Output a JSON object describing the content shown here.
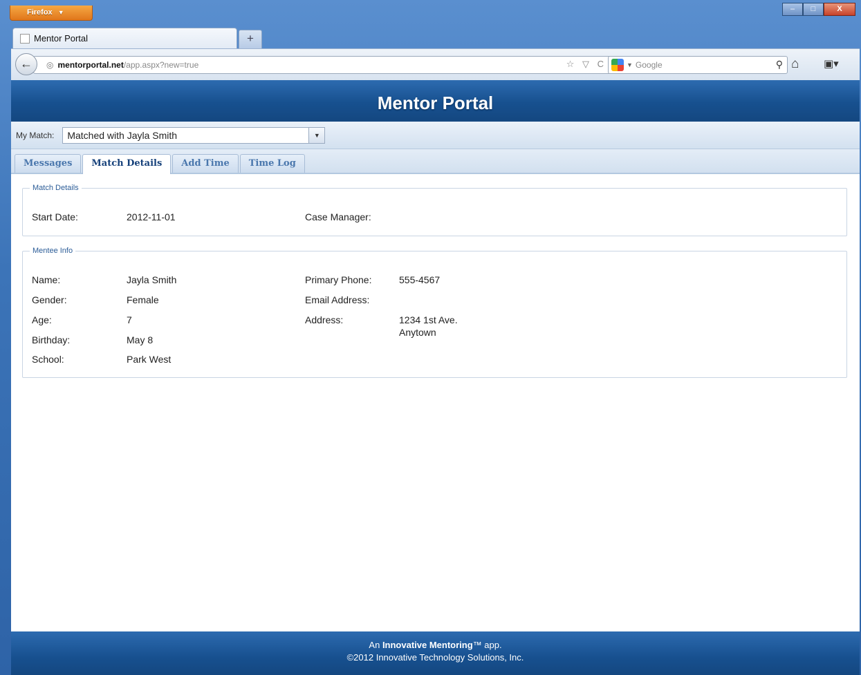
{
  "browser": {
    "menu_button_label": "Firefox",
    "menu_caret": "▼",
    "window_controls": {
      "minimize": "–",
      "maximize": "□",
      "close": "X"
    },
    "tab_title": "Mentor Portal",
    "new_tab_label": "+",
    "url_domain": "mentorportal.net",
    "url_path": "/app.aspx?new=true",
    "url_actions": "☆ ▽ C",
    "search_placeholder": "Google",
    "search_caret": "▼"
  },
  "app": {
    "title": "Mentor Portal",
    "match_label": "My Match:",
    "match_selected": "Matched with Jayla Smith",
    "tabs": [
      {
        "label": "Messages",
        "active": false
      },
      {
        "label": "Match Details",
        "active": true
      },
      {
        "label": "Add Time",
        "active": false
      },
      {
        "label": "Time Log",
        "active": false
      }
    ]
  },
  "match_details": {
    "legend": "Match Details",
    "start_date_label": "Start Date:",
    "start_date_value": "2012-11-01",
    "case_manager_label": "Case Manager:",
    "case_manager_value": ""
  },
  "mentee_info": {
    "legend": "Mentee Info",
    "name_label": "Name:",
    "name_value": "Jayla Smith",
    "gender_label": "Gender:",
    "gender_value": "Female",
    "age_label": "Age:",
    "age_value": "7",
    "birthday_label": "Birthday:",
    "birthday_value": "May 8",
    "school_label": "School:",
    "school_value": "Park West",
    "phone_label": "Primary Phone:",
    "phone_value": "555-4567",
    "email_label": "Email Address:",
    "email_value": "",
    "address_label": "Address:",
    "address_line1": "1234 1st Ave.",
    "address_line2": "Anytown"
  },
  "footer": {
    "line1_prefix": "An",
    "line1_brand": "Innovative Mentoring",
    "line1_suffix": "™ app.",
    "line2": "©2012 Innovative Technology Solutions, Inc."
  },
  "colors": {
    "header_blue": "#17508f",
    "tab_text": "#4a77ad",
    "firefox_orange": "#e0761b"
  }
}
